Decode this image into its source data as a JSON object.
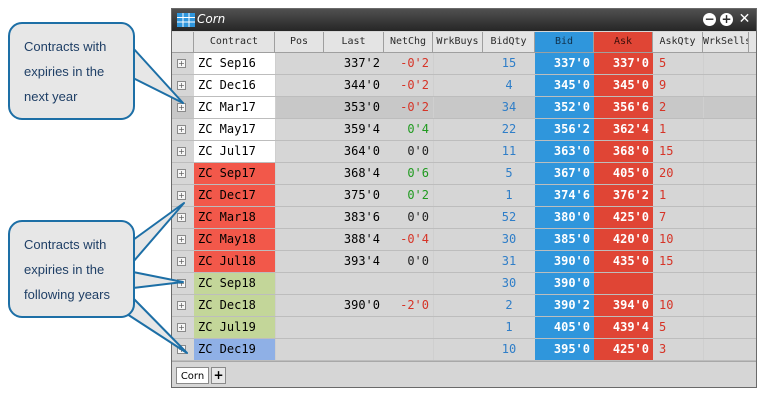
{
  "window": {
    "title": "Corn",
    "icon": "grid-icon"
  },
  "columns": [
    "Contract",
    "Pos",
    "Last",
    "NetChg",
    "WrkBuys",
    "BidQty",
    "Bid",
    "Ask",
    "AskQty",
    "WrkSells"
  ],
  "rows": [
    {
      "contract": "ZC Sep16",
      "last": "337'2",
      "netchg": "-0'2",
      "bidqty": "15",
      "bid": "337'0",
      "ask": "337'0",
      "askqty": "5"
    },
    {
      "contract": "ZC Dec16",
      "last": "344'0",
      "netchg": "-0'2",
      "bidqty": "4",
      "bid": "345'0",
      "ask": "345'0",
      "askqty": "9"
    },
    {
      "contract": "ZC Mar17",
      "last": "353'0",
      "netchg": "-0'2",
      "bidqty": "34",
      "bid": "352'0",
      "ask": "356'6",
      "askqty": "2"
    },
    {
      "contract": "ZC May17",
      "last": "359'4",
      "netchg": "0'4",
      "bidqty": "22",
      "bid": "356'2",
      "ask": "362'4",
      "askqty": "1"
    },
    {
      "contract": "ZC Jul17",
      "last": "364'0",
      "netchg": "0'0",
      "bidqty": "11",
      "bid": "363'0",
      "ask": "368'0",
      "askqty": "15"
    },
    {
      "contract": "ZC Sep17",
      "last": "368'4",
      "netchg": "0'6",
      "bidqty": "5",
      "bid": "367'0",
      "ask": "405'0",
      "askqty": "20"
    },
    {
      "contract": "ZC Dec17",
      "last": "375'0",
      "netchg": "0'2",
      "bidqty": "1",
      "bid": "374'6",
      "ask": "376'2",
      "askqty": "1"
    },
    {
      "contract": "ZC Mar18",
      "last": "383'6",
      "netchg": "0'0",
      "bidqty": "52",
      "bid": "380'0",
      "ask": "425'0",
      "askqty": "7"
    },
    {
      "contract": "ZC May18",
      "last": "388'4",
      "netchg": "-0'4",
      "bidqty": "30",
      "bid": "385'0",
      "ask": "420'0",
      "askqty": "10"
    },
    {
      "contract": "ZC Jul18",
      "last": "393'4",
      "netchg": "0'0",
      "bidqty": "31",
      "bid": "390'0",
      "ask": "435'0",
      "askqty": "15"
    },
    {
      "contract": "ZC Sep18",
      "last": "",
      "netchg": "",
      "bidqty": "30",
      "bid": "390'0",
      "ask": "",
      "askqty": ""
    },
    {
      "contract": "ZC Dec18",
      "last": "390'0",
      "netchg": "-2'0",
      "bidqty": "2",
      "bid": "390'2",
      "ask": "394'0",
      "askqty": "10"
    },
    {
      "contract": "ZC Jul19",
      "last": "",
      "netchg": "",
      "bidqty": "1",
      "bid": "405'0",
      "ask": "439'4",
      "askqty": "5"
    },
    {
      "contract": "ZC Dec19",
      "last": "",
      "netchg": "",
      "bidqty": "10",
      "bid": "395'0",
      "ask": "425'0",
      "askqty": "3"
    }
  ],
  "tabs": {
    "active": "Corn",
    "add_label": "+"
  },
  "callouts": {
    "next_year": [
      "Contracts with",
      "expiries in the",
      "next year"
    ],
    "following_years": [
      "Contracts with",
      "expiries in the",
      "following years"
    ]
  },
  "colors": {
    "bid": "#2f96dc",
    "ask": "#e04535",
    "next_year": "#ffffff",
    "red_group": "#f2584a",
    "green_group": "#c3d699",
    "blue_group": "#8fb0e6",
    "callout_border": "#1d6fa6"
  }
}
